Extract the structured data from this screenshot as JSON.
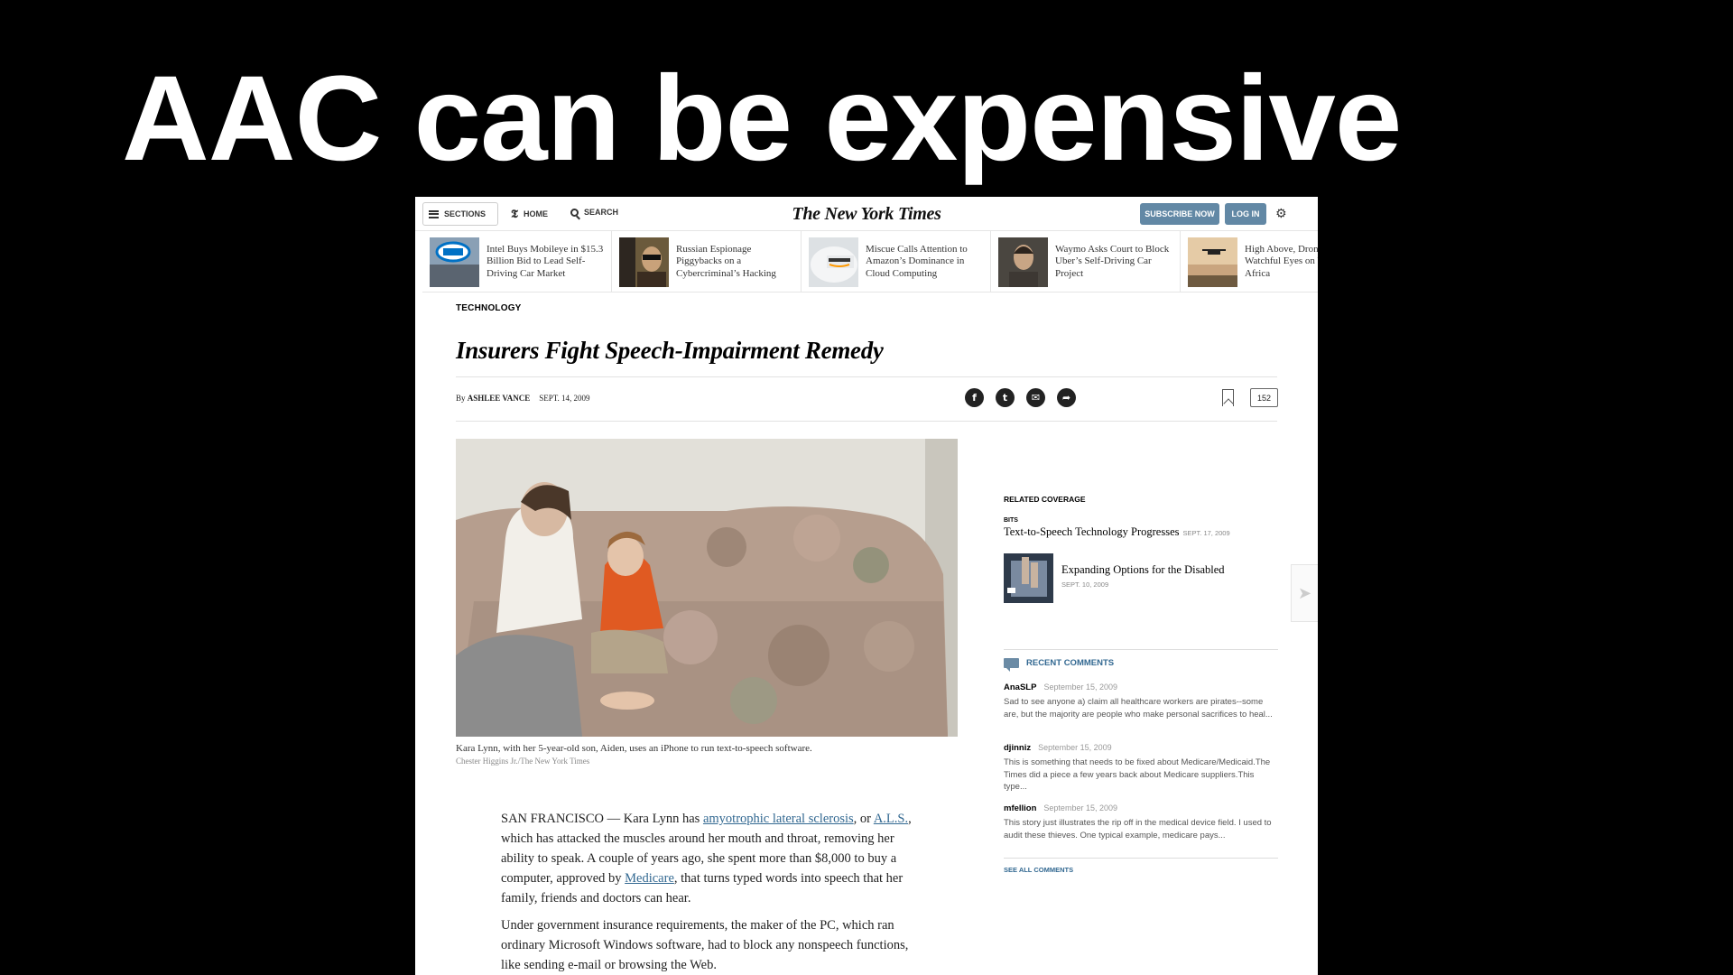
{
  "slide": {
    "title": "AAC can be expensive"
  },
  "nav": {
    "sections_label": "SECTIONS",
    "home_label": "HOME",
    "search_label": "SEARCH",
    "masthead": "The New York Times",
    "subscribe_label": "SUBSCRIBE NOW",
    "login_label": "LOG IN",
    "settings_icon": "gear-icon"
  },
  "ribbon": [
    {
      "headline": "Intel Buys Mobileye in $15.3 Billion Bid to Lead Self-Driving Car Market"
    },
    {
      "headline": "Russian Espionage Piggybacks on a Cybercriminal’s Hacking"
    },
    {
      "headline": "Miscue Calls Attention to Amazon’s Dominance in Cloud Computing"
    },
    {
      "headline": "Waymo Asks Court to Block Uber’s Self-Driving Car Project"
    },
    {
      "headline": "High Above, Drones Keep Watchful Eyes on Wildlife in Africa"
    }
  ],
  "article": {
    "kicker": "TECHNOLOGY",
    "headline": "Insurers Fight Speech-Impairment Remedy",
    "by": "By",
    "author": "ASHLEE VANCE",
    "date": "SEPT. 14, 2009",
    "comment_count": "152",
    "caption": "Kara Lynn, with her 5-year-old son, Aiden, uses an iPhone to run text-to-speech software.",
    "credit": "Chester Higgins Jr./The New York Times",
    "p1": {
      "a": "SAN FRANCISCO — Kara Lynn has ",
      "link1": "amyotrophic lateral sclerosis",
      "b": ", or ",
      "link2": "A.L.S.",
      "c": ", which has attacked the muscles around her mouth and throat, removing her ability to speak. A couple of years ago, she spent more than $8,000 to buy a computer, approved by ",
      "link3": "Medicare",
      "d": ", that turns typed words into speech that her family, friends and doctors can hear."
    },
    "p2": "Under government insurance requirements, the maker of the PC, which ran ordinary Microsoft Windows software, had to block any nonspeech functions, like sending e-mail or browsing the Web."
  },
  "sidebar": {
    "related_label": "RELATED COVERAGE",
    "bits_label": "BITS",
    "related1_title": "Text-to-Speech Technology Progresses",
    "related1_date": "SEPT. 17, 2009",
    "related2_title": "Expanding Options for the Disabled",
    "related2_date": "SEPT. 10, 2009",
    "recent_label": "RECENT COMMENTS",
    "comments": [
      {
        "user": "AnaSLP",
        "date": "September 15, 2009",
        "text": "Sad to see anyone a) claim all healthcare workers are pirates--some are, but the majority are people who make personal sacrifices to heal..."
      },
      {
        "user": "djinniz",
        "date": "September 15, 2009",
        "text": "This is something that needs to be fixed about Medicare/Medicaid.The Times did a piece a few years back about Medicare suppliers.This type..."
      },
      {
        "user": "mfellion",
        "date": "September 15, 2009",
        "text": "This story just illustrates the rip off in the medical device field. I used to audit these thieves. One typical example, medicare pays..."
      }
    ],
    "see_all": "SEE ALL COMMENTS"
  }
}
